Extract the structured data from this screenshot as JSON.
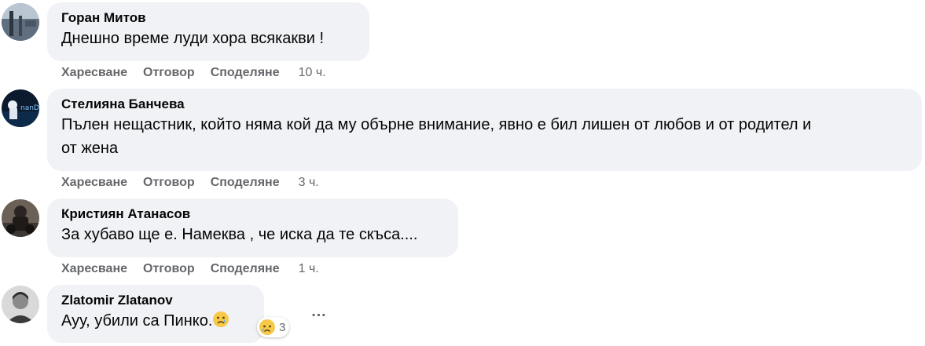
{
  "actions": {
    "like": "Харесване",
    "reply": "Отговор",
    "share": "Споделяне"
  },
  "comments": [
    {
      "author": "Горан Митов",
      "text": "Днешно време луди хора всякакви !",
      "time": "10 ч."
    },
    {
      "author": "Стелияна Банчева",
      "text_line1": "Пълен нещастник, който няма кой да му обърне внимание, явно е бил лишен от любов и от родител и",
      "text_line2": "от жена",
      "time": "3 ч.",
      "avatar_text": "nanDs"
    },
    {
      "author": "Кристиян Атанасов",
      "text": "За хубаво ще е. Намеква , че иска да те скъса....",
      "time": "1 ч."
    },
    {
      "author": "Zlatomir Zlatanov",
      "text": "Ауу, убили са Пинко.",
      "reaction": {
        "icon": "sad-reaction-icon",
        "count": "3"
      },
      "more_label": "…"
    }
  ],
  "colors": {
    "bubble": "#f0f2f5",
    "meta": "#65676b",
    "text": "#050505"
  }
}
